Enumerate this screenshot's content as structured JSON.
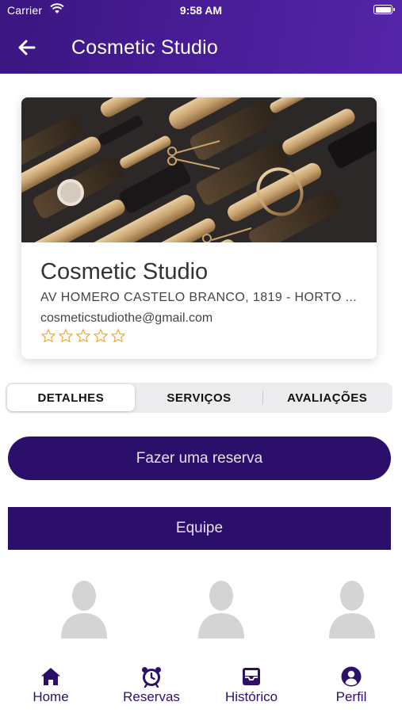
{
  "status_bar": {
    "carrier": "Carrier",
    "time": "9:58 AM"
  },
  "header": {
    "title": "Cosmetic Studio"
  },
  "card": {
    "name": "Cosmetic Studio",
    "address": "AV HOMERO CASTELO BRANCO, 1819 - HORTO ...",
    "email": "cosmeticstudiothe@gmail.com",
    "rating": 0,
    "rating_max": 5
  },
  "tabs": [
    {
      "label": "DETALHES",
      "active": true
    },
    {
      "label": "SERVIÇOS",
      "active": false
    },
    {
      "label": "AVALIAÇÕES",
      "active": false
    }
  ],
  "reserve_button": "Fazer uma reserva",
  "team_title": "Equipe",
  "bottom_nav": [
    {
      "label": "Home",
      "icon": "home-icon"
    },
    {
      "label": "Reservas",
      "icon": "alarm-clock-icon"
    },
    {
      "label": "Histórico",
      "icon": "inbox-icon"
    },
    {
      "label": "Perfil",
      "icon": "user-circle-icon"
    }
  ],
  "colors": {
    "header": "#4a1e9a",
    "primary": "#2c0f6b",
    "star_outline": "#f5a623"
  }
}
